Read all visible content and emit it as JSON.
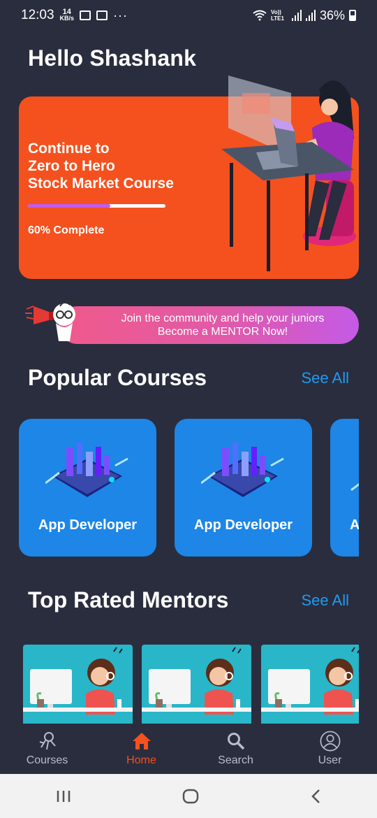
{
  "status_bar": {
    "time": "12:03",
    "data_rate_value": "14",
    "data_rate_unit": "KB/s",
    "overflow": "···",
    "network": "Vo)) LTE1",
    "battery": "36%"
  },
  "greeting": "Hello Shashank",
  "continue_course": {
    "line1": "Continue to",
    "line2": "Zero to Hero",
    "line3": "Stock Market Course",
    "progress": 0.6,
    "progress_label": "60% Complete",
    "accent": "#f4511e"
  },
  "mentor_banner": {
    "line1": "Join the community and help your juniors",
    "line2": "Become a MENTOR Now!"
  },
  "popular_courses": {
    "title": "Popular Courses",
    "see_all": "See All",
    "items": [
      {
        "label": "App Developer"
      },
      {
        "label": "App Developer"
      },
      {
        "label": "A"
      }
    ]
  },
  "top_mentors": {
    "title": "Top Rated Mentors",
    "see_all": "See All"
  },
  "bottom_nav": {
    "items": [
      {
        "label": "Courses",
        "icon": "astronaut-icon"
      },
      {
        "label": "Home",
        "icon": "home-icon",
        "active": true
      },
      {
        "label": "Search",
        "icon": "search-icon"
      },
      {
        "label": "User",
        "icon": "user-icon"
      }
    ]
  },
  "colors": {
    "background": "#2a2d3e",
    "link": "#1e9bf0",
    "tile": "#1d86e6",
    "nav_active": "#f4511e"
  }
}
